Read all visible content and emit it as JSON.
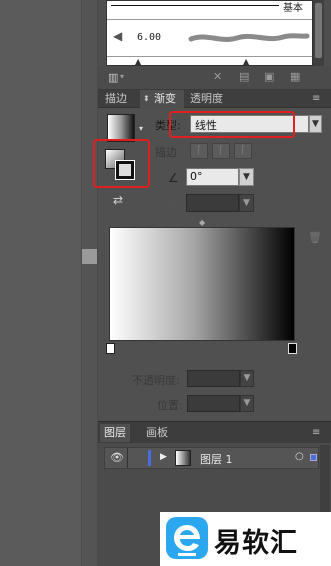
{
  "brushes": {
    "row1_label": "基本",
    "row2_value": "6.00"
  },
  "tabs": [
    {
      "label": "描边"
    },
    {
      "label": "渐变"
    },
    {
      "label": "透明度"
    }
  ],
  "gradient": {
    "type_label": "类型:",
    "type_value": "线性",
    "stroke_label": "描边",
    "angle_value": "0°",
    "opacity_label": "不透明度:",
    "position_label": "位置:"
  },
  "layers": {
    "tabs": [
      {
        "label": "图层"
      },
      {
        "label": "画板"
      }
    ],
    "rows": [
      {
        "name": "图层 1"
      }
    ]
  },
  "watermark": {
    "text": "易软汇"
  },
  "colors": {
    "panel_bg": "#505050",
    "highlight": "#e02020",
    "watermark_blue": "#2aa7ee"
  }
}
